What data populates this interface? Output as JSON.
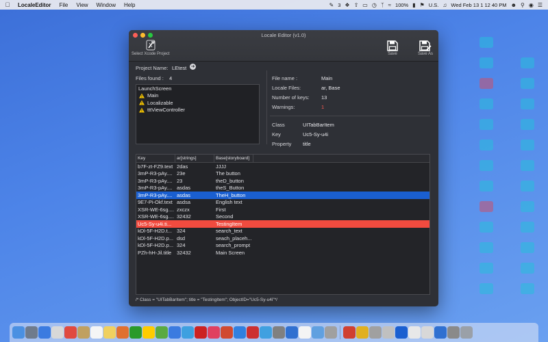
{
  "menubar": {
    "app_name": "LocaleEditor",
    "menus": [
      "File",
      "View",
      "Window",
      "Help"
    ],
    "status": {
      "badge_count": "3",
      "battery": "100%",
      "input_source": "U.S.",
      "clock": "Wed Feb 13  1 12 40 PM"
    }
  },
  "window": {
    "title": "Locale Editor (v1.0)",
    "toolbar": {
      "select_label": "Select Xcode Project",
      "save_label": "Save",
      "save_as_label": "Save As"
    },
    "project": {
      "name_label": "Project Name:",
      "name_value": "LEtest",
      "files_found_label": "Files found :",
      "files_found_value": "4"
    },
    "files": [
      {
        "name": "LaunchScreen",
        "warning": false
      },
      {
        "name": "Main",
        "warning": true
      },
      {
        "name": "Localizable",
        "warning": true
      },
      {
        "name": "tttViewController",
        "warning": true
      }
    ],
    "file_info": {
      "file_name_label": "File name :",
      "file_name_value": "Main",
      "locale_files_label": "Locale Files:",
      "locale_files_value": "ar, Base",
      "num_keys_label": "Number of keys:",
      "num_keys_value": "13",
      "warnings_label": "Warnings:",
      "warnings_value": "1"
    },
    "object_info": {
      "class_label": "Class",
      "class_value": "UITabBarItem",
      "key_label": "Key",
      "key_value": "Uc5-Sy-u4i",
      "property_label": "Property",
      "property_value": "title"
    },
    "table": {
      "columns": [
        "Key",
        "ar[strings]",
        "Base[storyboard]"
      ],
      "rows": [
        {
          "key": "b7F-zt-FZ9.text",
          "ar": "2das",
          "base": "JJJJ",
          "state": ""
        },
        {
          "key": "3mP-R3-pAy....",
          "ar": "23e",
          "base": "The button",
          "state": ""
        },
        {
          "key": "3mP-R3-pAy....",
          "ar": "23",
          "base": "theD_button",
          "state": ""
        },
        {
          "key": "3mP-R3-pAy....",
          "ar": "asdas",
          "base": "theS_Button",
          "state": ""
        },
        {
          "key": "3mP-R3-pAy....",
          "ar": "asdas",
          "base": "TheH_button",
          "state": "selected"
        },
        {
          "key": "9E7-Pi-Okf.text",
          "ar": "asdsa",
          "base": "English text",
          "state": ""
        },
        {
          "key": "XSR-WE-6sg....",
          "ar": "zxczx",
          "base": "First",
          "state": ""
        },
        {
          "key": "XSR-WE-6sg....",
          "ar": "32432",
          "base": "Second",
          "state": ""
        },
        {
          "key": "Uc5-Sy-u4i.ti...",
          "ar": "",
          "base": "TestingItem",
          "state": "warning"
        },
        {
          "key": "kDl-5F-H2D.t...",
          "ar": "324",
          "base": "search_text",
          "state": ""
        },
        {
          "key": "kDl-5F-H2D.p...",
          "ar": "dsd",
          "base": "seach_placeh...",
          "state": ""
        },
        {
          "key": "kDl-5F-H2D.p...",
          "ar": "324",
          "base": "search_prompt",
          "state": ""
        },
        {
          "key": "PZh-hH-Jil.title",
          "ar": "32432",
          "base": "Main Screen",
          "state": ""
        }
      ]
    },
    "status_text": "/* Class = \"UITabBarItem\"; title = \"TestingItem\"; ObjectID=\"Uc5-Sy-u4i\"*/"
  },
  "colors": {
    "selected_row": "#1a5fd0",
    "warning_row": "#f14b3f",
    "warning_icon": "#f5c400",
    "window_bg": "#2e3036"
  }
}
